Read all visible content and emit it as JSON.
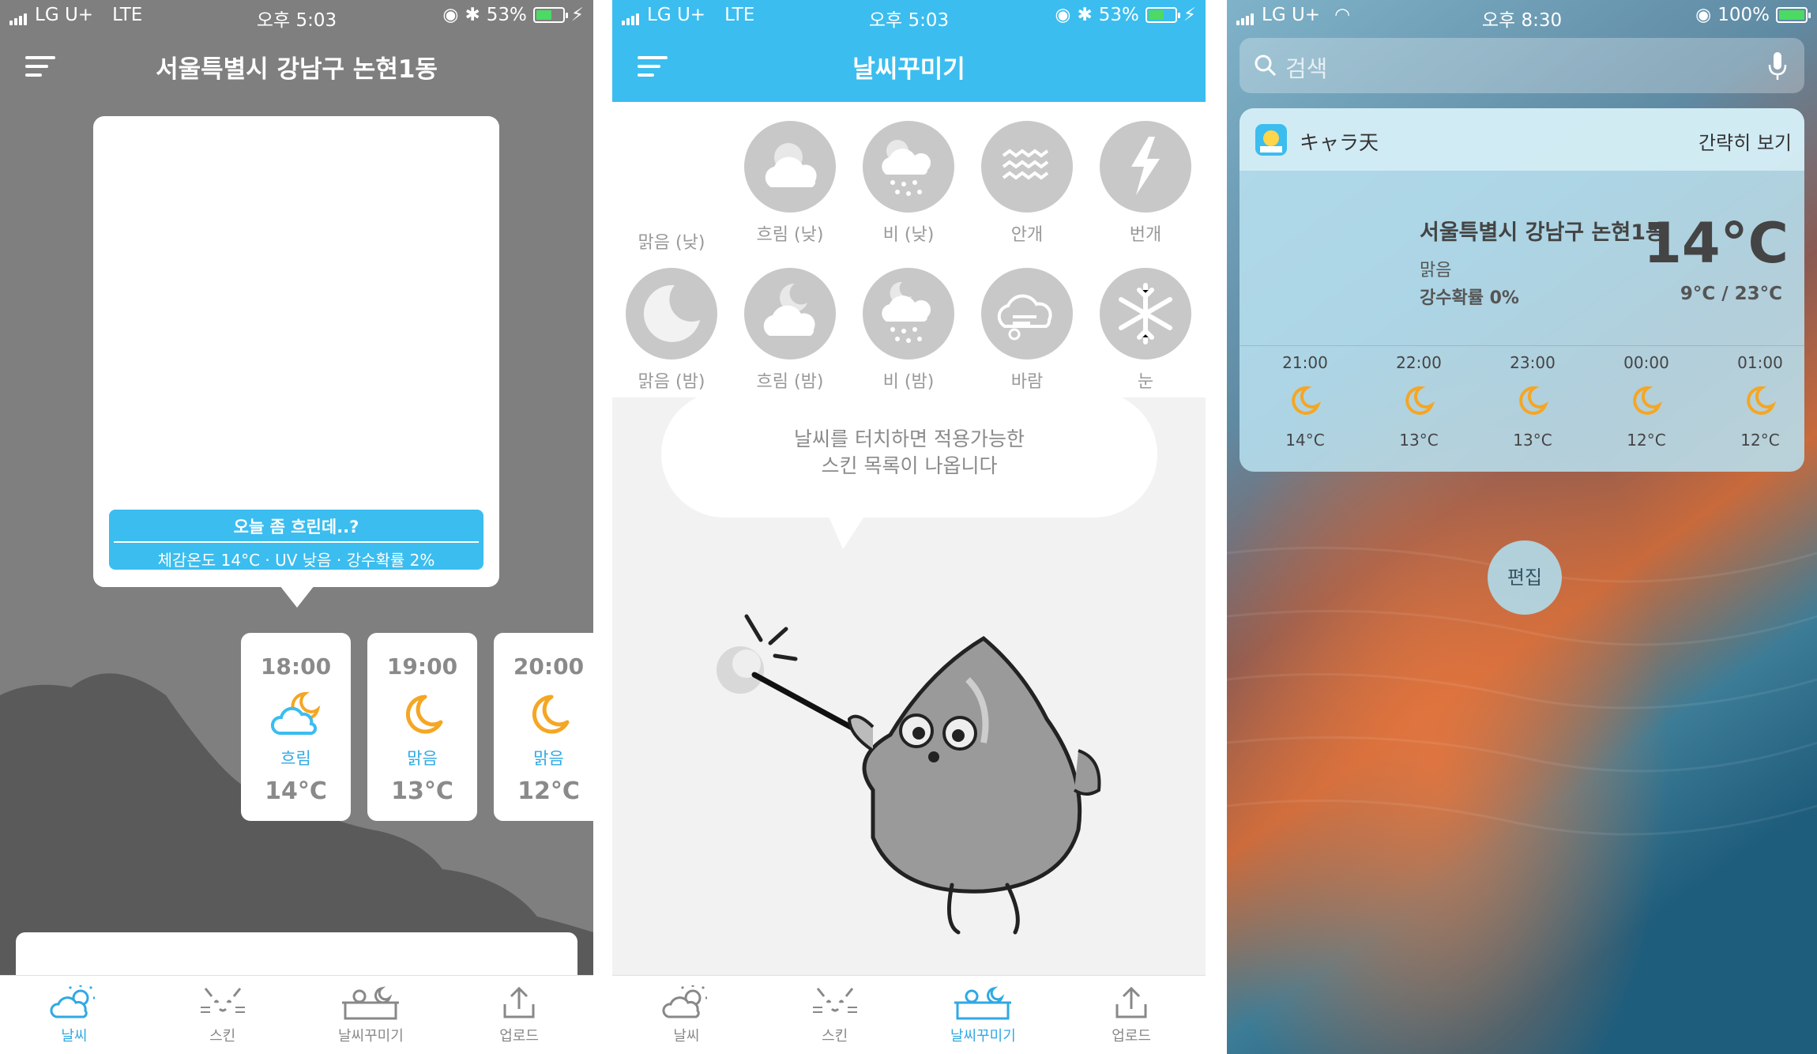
{
  "screen1": {
    "status": {
      "carrier": "LG U+",
      "network": "LTE",
      "time": "오후 5:03",
      "battery": "53%"
    },
    "header": {
      "title": "서울특별시 강남구 논현1동"
    },
    "message": {
      "title": "오늘 좀 흐린데..?",
      "detail": "체감온도 14°C · UV 낮음 · 강수확률 2%"
    },
    "hourly": [
      {
        "time": "18:00",
        "icon": "moon-cloud-icon",
        "desc": "흐림",
        "temp": "14°C"
      },
      {
        "time": "19:00",
        "icon": "moon-icon",
        "desc": "맑음",
        "temp": "13°C"
      },
      {
        "time": "20:00",
        "icon": "moon-icon",
        "desc": "맑음",
        "temp": "12°C"
      }
    ],
    "tabs": [
      {
        "label": "날씨",
        "icon": "weather-icon",
        "active": true
      },
      {
        "label": "스킨",
        "icon": "cat-face-icon",
        "active": false
      },
      {
        "label": "날씨꾸미기",
        "icon": "weather-decorate-icon",
        "active": false
      },
      {
        "label": "업로드",
        "icon": "upload-icon",
        "active": false
      }
    ]
  },
  "screen2": {
    "status": {
      "carrier": "LG U+",
      "network": "LTE",
      "time": "오후 5:03",
      "battery": "53%"
    },
    "header": {
      "title": "날씨꾸미기"
    },
    "weather_types": [
      {
        "label": "맑음 (낮)",
        "icon": "sun-icon"
      },
      {
        "label": "흐림 (낮)",
        "icon": "sun-cloud-icon"
      },
      {
        "label": "비 (낮)",
        "icon": "sun-rain-icon"
      },
      {
        "label": "안개",
        "icon": "fog-icon"
      },
      {
        "label": "번개",
        "icon": "lightning-icon"
      },
      {
        "label": "맑음 (밤)",
        "icon": "moon-icon"
      },
      {
        "label": "흐림 (밤)",
        "icon": "moon-cloud-icon"
      },
      {
        "label": "비 (밤)",
        "icon": "moon-rain-icon"
      },
      {
        "label": "바람",
        "icon": "wind-icon"
      },
      {
        "label": "눈",
        "icon": "snow-icon"
      }
    ],
    "hint": {
      "line1": "날씨를 터치하면 적용가능한",
      "line2": "스킨 목록이 나옵니다"
    },
    "tabs": [
      {
        "label": "날씨",
        "icon": "weather-icon",
        "active": false
      },
      {
        "label": "스킨",
        "icon": "cat-face-icon",
        "active": false
      },
      {
        "label": "날씨꾸미기",
        "icon": "weather-decorate-icon",
        "active": true
      },
      {
        "label": "업로드",
        "icon": "upload-icon",
        "active": false
      }
    ]
  },
  "screen3": {
    "status": {
      "carrier": "LG U+",
      "time": "오후 8:30",
      "battery": "100%"
    },
    "search": {
      "placeholder": "검색"
    },
    "widget": {
      "app_name": "キャラ天",
      "show_less": "간략히 보기",
      "location": "서울특별시 강남구 논현1동",
      "condition": "맑음",
      "precip": "강수확률 0%",
      "temp": "14°C",
      "range": "9°C / 23°C",
      "hourly": [
        {
          "time": "21:00",
          "icon": "moon-icon",
          "temp": "14°C"
        },
        {
          "time": "22:00",
          "icon": "moon-icon",
          "temp": "13°C"
        },
        {
          "time": "23:00",
          "icon": "moon-icon",
          "temp": "13°C"
        },
        {
          "time": "00:00",
          "icon": "moon-icon",
          "temp": "12°C"
        },
        {
          "time": "01:00",
          "icon": "moon-icon",
          "temp": "12°C"
        }
      ]
    },
    "edit_label": "편집"
  },
  "colors": {
    "accent": "#3bbdef",
    "moon": "#f5a623",
    "gray_bg": "#7f7f7f"
  }
}
